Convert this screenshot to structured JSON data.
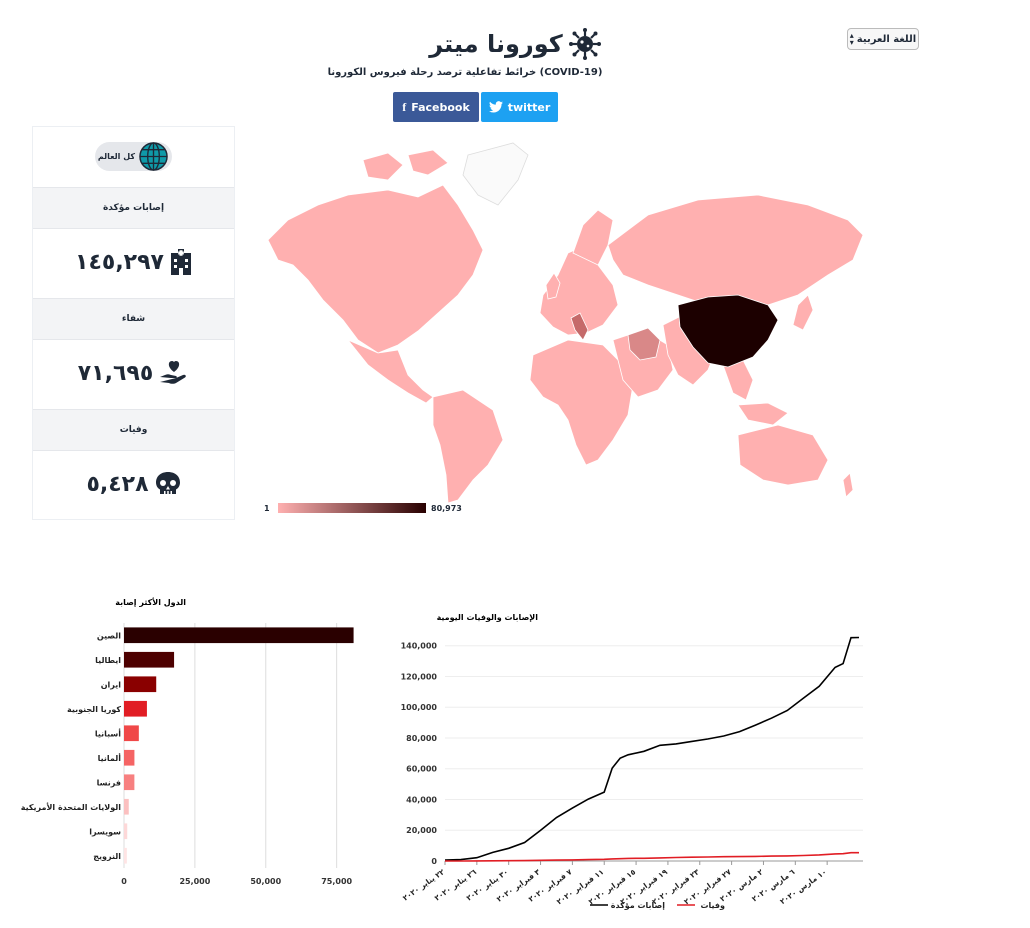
{
  "header": {
    "language_label": "اللغة العربية",
    "title": "كورونا ميتر",
    "subtitle": "خرائط تفاعلية ترصد رحلة فيروس الكورونا (COVID-19)",
    "facebook_label": "Facebook",
    "twitter_label": "twitter"
  },
  "icons": {
    "virus": "virus-icon",
    "globe": "globe-icon",
    "hospital": "hospital-icon",
    "heart_hand": "heart-hand-icon",
    "skull": "skull-icon",
    "facebook": "facebook-icon",
    "twitter": "twitter-icon"
  },
  "colors": {
    "facebook": "#3b5998",
    "twitter": "#1da1f2",
    "map_low": "#ffb0b0",
    "map_high": "#280000",
    "deaths_line": "#e11d24"
  },
  "stats": {
    "scope_label": "كل العالم",
    "confirmed_label": "إصابات مؤكدة",
    "confirmed_value": "١٤٥,٢٩٧",
    "recovered_label": "شفاء",
    "recovered_value": "٧١,٦٩٥",
    "deaths_label": "وفيات",
    "deaths_value": "٥,٤٢٨"
  },
  "map": {
    "legend_min": "1",
    "legend_max": "80,973"
  },
  "chart_data": [
    {
      "type": "bar",
      "orientation": "horizontal",
      "title": "الدول الأكثر إصابة",
      "categories": [
        "الصين",
        "ايطاليا",
        "ايران",
        "كوريا الجنوبية",
        "أسبانيا",
        "ألمانيا",
        "فرنسا",
        "الولايات المتحدة الأمريكية",
        "سويسرا",
        "النرويج"
      ],
      "values": [
        80973,
        17660,
        11364,
        8086,
        5232,
        3675,
        3661,
        1678,
        1139,
        996
      ],
      "colors": [
        "#2a0000",
        "#4d0000",
        "#8a0000",
        "#e11d24",
        "#f04848",
        "#f56464",
        "#f78080",
        "#fbc0c0",
        "#fdd8d8",
        "#fee4e4"
      ],
      "xlim": [
        0,
        85000
      ],
      "xticks": [
        "0",
        "25,000",
        "50,000",
        "75,000"
      ],
      "xtick_values": [
        0,
        25000,
        50000,
        75000
      ],
      "grid": true
    },
    {
      "type": "line",
      "title": "الإصابات والوفيات اليومية",
      "x": [
        "2020-01-22",
        "2020-01-24",
        "2020-01-26",
        "2020-01-28",
        "2020-01-30",
        "2020-02-01",
        "2020-02-03",
        "2020-02-05",
        "2020-02-07",
        "2020-02-09",
        "2020-02-11",
        "2020-02-12",
        "2020-02-13",
        "2020-02-14",
        "2020-02-16",
        "2020-02-18",
        "2020-02-20",
        "2020-02-22",
        "2020-02-24",
        "2020-02-26",
        "2020-02-28",
        "2020-03-01",
        "2020-03-03",
        "2020-03-05",
        "2020-03-07",
        "2020-03-09",
        "2020-03-11",
        "2020-03-12",
        "2020-03-13",
        "2020-03-14"
      ],
      "xticks": [
        "٢٢ يناير ٢٠٢٠",
        "٢٦ يناير ٢٠٢٠",
        "٣٠ يناير ٢٠٢٠",
        "٣ فبراير ٢٠٢٠",
        "٧ فبراير ٢٠٢٠",
        "١١ فبراير ٢٠٢٠",
        "١٥ فبراير ٢٠٢٠",
        "١٩ فبراير ٢٠٢٠",
        "٢٣ فبراير ٢٠٢٠",
        "٢٧ فبراير ٢٠٢٠",
        "٢ مارس ٢٠٢٠",
        "٦ مارس ٢٠٢٠",
        "١٠ مارس ٢٠٢٠"
      ],
      "xtick_dates": [
        "2020-01-22",
        "2020-01-26",
        "2020-01-30",
        "2020-02-03",
        "2020-02-07",
        "2020-02-11",
        "2020-02-15",
        "2020-02-19",
        "2020-02-23",
        "2020-02-27",
        "2020-03-02",
        "2020-03-06",
        "2020-03-10"
      ],
      "series": [
        {
          "name": "إصابات مؤكدة",
          "color": "#000000",
          "values": [
            555,
            941,
            2118,
            5578,
            8234,
            12038,
            19881,
            28276,
            34392,
            40235,
            44800,
            60374,
            66887,
            69032,
            71329,
            75204,
            76169,
            77754,
            79356,
            81287,
            84124,
            88371,
            92836,
            97882,
            105821,
            113584,
            125865,
            128343,
            145193,
            145297
          ]
        },
        {
          "name": "وفيات",
          "color": "#e11d24",
          "values": [
            17,
            26,
            56,
            131,
            171,
            259,
            427,
            565,
            722,
            908,
            1113,
            1370,
            1523,
            1666,
            1770,
            2009,
            2247,
            2461,
            2629,
            2770,
            2872,
            2996,
            3160,
            3348,
            3558,
            3988,
            4615,
            4720,
            5404,
            5428
          ]
        }
      ],
      "ylim": [
        0,
        145000
      ],
      "yticks": [
        "0",
        "20,000",
        "40,000",
        "60,000",
        "80,000",
        "100,000",
        "120,000",
        "140,000"
      ],
      "ytick_values": [
        0,
        20000,
        40000,
        60000,
        80000,
        100000,
        120000,
        140000
      ],
      "grid": true,
      "legend_position": "bottom"
    }
  ]
}
